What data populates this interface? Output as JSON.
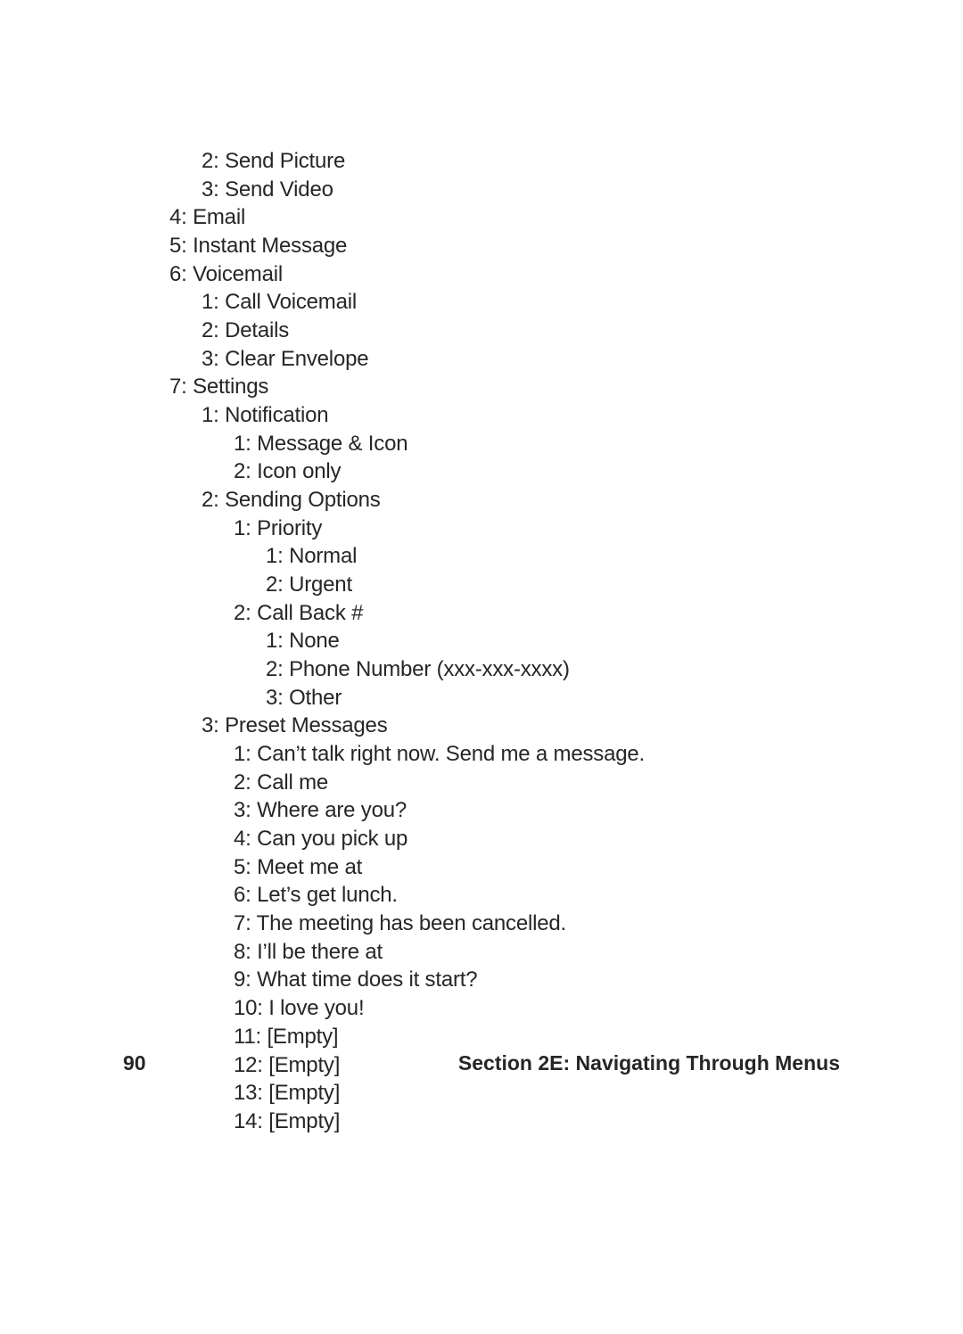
{
  "entries": [
    {
      "indent": 2,
      "num": "2",
      "label": "Send Picture"
    },
    {
      "indent": 2,
      "num": "3",
      "label": "Send Video"
    },
    {
      "indent": 1,
      "num": "4",
      "label": "Email"
    },
    {
      "indent": 1,
      "num": "5",
      "label": "Instant Message"
    },
    {
      "indent": 1,
      "num": "6",
      "label": "Voicemail"
    },
    {
      "indent": 2,
      "num": "1",
      "label": "Call Voicemail"
    },
    {
      "indent": 2,
      "num": "2",
      "label": "Details"
    },
    {
      "indent": 2,
      "num": "3",
      "label": "Clear Envelope"
    },
    {
      "indent": 1,
      "num": "7",
      "label": "Settings"
    },
    {
      "indent": 2,
      "num": "1",
      "label": "Notification"
    },
    {
      "indent": 3,
      "num": "1",
      "label": "Message & Icon"
    },
    {
      "indent": 3,
      "num": "2",
      "label": "Icon only"
    },
    {
      "indent": 2,
      "num": "2",
      "label": "Sending Options"
    },
    {
      "indent": 3,
      "num": "1",
      "label": "Priority"
    },
    {
      "indent": 4,
      "num": "1",
      "label": "Normal"
    },
    {
      "indent": 4,
      "num": "2",
      "label": "Urgent"
    },
    {
      "indent": 3,
      "num": "2",
      "label": "Call Back #"
    },
    {
      "indent": 4,
      "num": "1",
      "label": "None"
    },
    {
      "indent": 4,
      "num": "2",
      "label": "Phone Number (xxx-xxx-xxxx)"
    },
    {
      "indent": 4,
      "num": "3",
      "label": "Other"
    },
    {
      "indent": 2,
      "num": "3",
      "label": "Preset Messages"
    },
    {
      "indent": 3,
      "num": "1",
      "label": "Can’t talk right now. Send me a message."
    },
    {
      "indent": 3,
      "num": "2",
      "label": "Call me"
    },
    {
      "indent": 3,
      "num": "3",
      "label": "Where are you?"
    },
    {
      "indent": 3,
      "num": "4",
      "label": "Can you pick up"
    },
    {
      "indent": 3,
      "num": "5",
      "label": "Meet me at"
    },
    {
      "indent": 3,
      "num": "6",
      "label": "Let’s get lunch."
    },
    {
      "indent": 3,
      "num": "7",
      "label": "The meeting has been cancelled."
    },
    {
      "indent": 3,
      "num": "8",
      "label": "I’ll be there at"
    },
    {
      "indent": 3,
      "num": "9",
      "label": "What time does it start?"
    },
    {
      "indent": 3,
      "num": "10",
      "label": "I love you!"
    },
    {
      "indent": 3,
      "num": "11",
      "label": "[Empty]"
    },
    {
      "indent": 3,
      "num": "12",
      "label": "[Empty]"
    },
    {
      "indent": 3,
      "num": "13",
      "label": "[Empty]"
    },
    {
      "indent": 3,
      "num": "14",
      "label": "[Empty]"
    }
  ],
  "footer": {
    "page_number": "90",
    "section_title": "Section 2E: Navigating Through Menus"
  }
}
